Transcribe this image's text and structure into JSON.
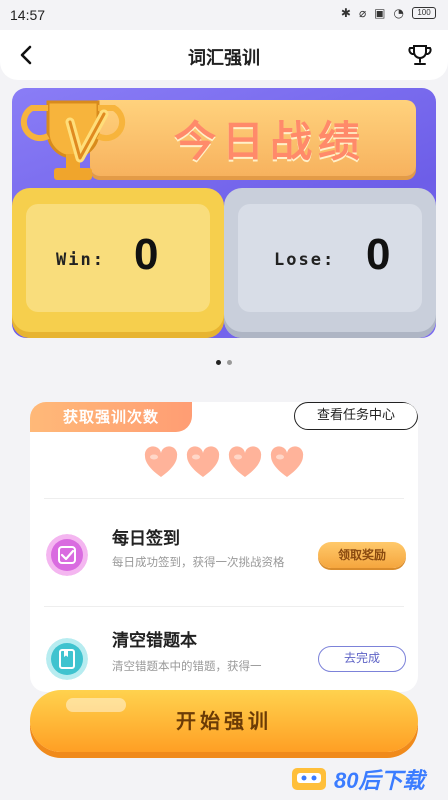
{
  "status_bar": {
    "time": "14:57",
    "battery": "100"
  },
  "nav": {
    "title": "词汇强训"
  },
  "banner": {
    "title": "今日战绩",
    "win_label": "Win:",
    "win_value": "0",
    "lose_label": "Lose:",
    "lose_value": "0"
  },
  "pager": {
    "count": 2,
    "active": 0
  },
  "tasks_card": {
    "header_label": "获取强训次数",
    "task_center_link": "查看任务中心",
    "hearts_count": 4,
    "tasks": [
      {
        "title": "每日签到",
        "desc": "每日成功签到，获得一次挑战资格",
        "action": "领取奖励"
      },
      {
        "title": "清空错题本",
        "desc": "清空错题本中的错题，获得一",
        "action": "去完成"
      }
    ]
  },
  "start_button": {
    "label": "开始强训"
  },
  "watermark": {
    "text": "80后下载"
  },
  "colors": {
    "banner_bg": "#7b6bf0",
    "win_card": "#f6cf4d",
    "lose_card": "#c9cfdb",
    "start_button": "#ffb338",
    "accent_orange": "#ff9d74"
  }
}
